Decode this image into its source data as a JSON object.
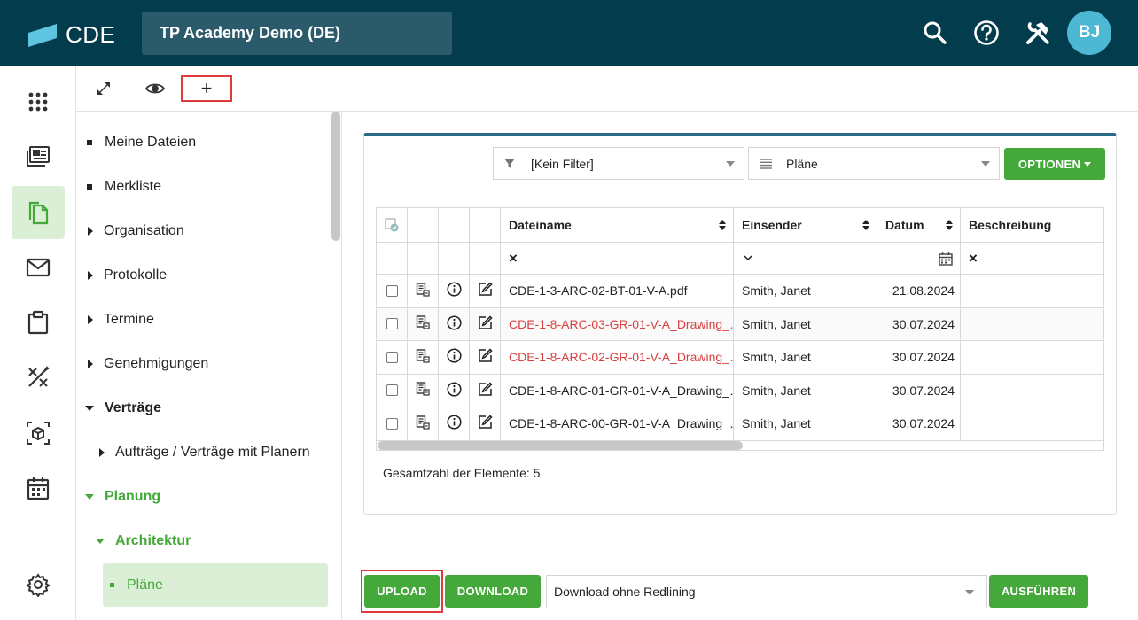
{
  "header": {
    "logo_text": "CDE",
    "project": "TP Academy Demo (DE)",
    "avatar_initials": "BJ",
    "icons": [
      "search-icon",
      "help-icon",
      "tools-icon"
    ]
  },
  "rail": {
    "items": [
      "apps-grid-icon",
      "dashboard-icon",
      "documents-icon",
      "mail-icon",
      "clipboard-icon",
      "design-tools-icon",
      "model-3d-icon",
      "calendar-icon",
      "settings-icon"
    ],
    "active": "documents-icon"
  },
  "toolbar": {
    "icons": [
      "collapse-icon",
      "eye-icon",
      "plus-icon"
    ],
    "plus_label": "+"
  },
  "tree": {
    "items": [
      {
        "label": "Meine Dateien",
        "marker": "bullet"
      },
      {
        "label": "Merkliste",
        "marker": "bullet"
      },
      {
        "label": "Organisation",
        "marker": "caret-right"
      },
      {
        "label": "Protokolle",
        "marker": "caret-right"
      },
      {
        "label": "Termine",
        "marker": "caret-right"
      },
      {
        "label": "Genehmigungen",
        "marker": "caret-right"
      },
      {
        "label": "Verträge",
        "marker": "caret-down"
      },
      {
        "label": "Aufträge / Verträge mit Planern",
        "marker": "caret-right"
      },
      {
        "label": "Planung",
        "marker": "caret-down"
      },
      {
        "label": "Architektur",
        "marker": "caret-down"
      },
      {
        "label": "Pläne",
        "marker": "bullet",
        "selected": true
      }
    ]
  },
  "filters": {
    "filter_value": "[Kein Filter]",
    "view_value": "Pläne",
    "options_label": "OPTIONEN"
  },
  "table": {
    "columns": [
      "Dateiname",
      "Einsender",
      "Datum",
      "Beschreibung"
    ],
    "filter_row": {
      "dateiname": "×",
      "einsender": "⌄",
      "beschreibung": "×"
    },
    "rows": [
      {
        "dateiname": "CDE-1-3-ARC-02-BT-01-V-A.pdf",
        "einsender": "Smith, Janet",
        "datum": "21.08.2024",
        "beschreibung": "",
        "highlight": false
      },
      {
        "dateiname": "CDE-1-8-ARC-03-GR-01-V-A_Drawing_…",
        "einsender": "Smith, Janet",
        "datum": "30.07.2024",
        "beschreibung": "",
        "highlight": true
      },
      {
        "dateiname": "CDE-1-8-ARC-02-GR-01-V-A_Drawing_…",
        "einsender": "Smith, Janet",
        "datum": "30.07.2024",
        "beschreibung": "",
        "highlight": true
      },
      {
        "dateiname": "CDE-1-8-ARC-01-GR-01-V-A_Drawing_…",
        "einsender": "Smith, Janet",
        "datum": "30.07.2024",
        "beschreibung": "",
        "highlight": false
      },
      {
        "dateiname": "CDE-1-8-ARC-00-GR-01-V-A_Drawing_…",
        "einsender": "Smith, Janet",
        "datum": "30.07.2024",
        "beschreibung": "",
        "highlight": false
      }
    ],
    "total_label": "Gesamtzahl der Elemente: 5"
  },
  "actions": {
    "upload_label": "UPLOAD",
    "download_label": "DOWNLOAD",
    "download_option": "Download ohne Redlining",
    "execute_label": "AUSFÜHREN"
  },
  "colors": {
    "header_bg": "#033c4d",
    "accent_green": "#45a83a",
    "link_red": "#d8413f",
    "highlight_red": "#e03a3a",
    "card_top": "#2a6a86"
  }
}
